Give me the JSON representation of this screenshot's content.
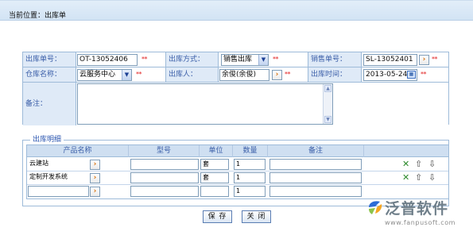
{
  "breadcrumb": "当前位置：出库单",
  "form": {
    "row1": {
      "doc_no_label": "出库单号：",
      "doc_no_value": "OT-13052406",
      "method_label": "出库方式：",
      "method_value": "销售出库",
      "sales_no_label": "销售单号：",
      "sales_no_value": "SL-13052401"
    },
    "row2": {
      "warehouse_label": "仓库名称：",
      "warehouse_value": "云服务中心",
      "person_label": "出库人：",
      "person_value": "余俊(余俊)",
      "time_label": "出库时间：",
      "time_value": "2013-05-24"
    },
    "row3": {
      "remark_label": "备注："
    },
    "required_mark": "**"
  },
  "details": {
    "legend": "出库明细",
    "headers": [
      "产品名称",
      "型号",
      "单位",
      "数量",
      "备注"
    ],
    "rows": [
      {
        "product": "云建站",
        "model": "",
        "unit": "套",
        "qty": "1",
        "remark": ""
      },
      {
        "product": "定制开发系统",
        "model": "",
        "unit": "套",
        "qty": "1",
        "remark": ""
      },
      {
        "product": "",
        "model": "",
        "unit": "",
        "qty": "1",
        "remark": ""
      }
    ]
  },
  "buttons": {
    "save": "保 存",
    "close": "关 闭"
  },
  "logo": {
    "name": "泛普软件",
    "url": "www.fanpusoft.com"
  },
  "icons": {
    "picker": "picker-arrow-icon",
    "calendar": "calendar-icon",
    "delete": "delete-x-icon",
    "up": "arrow-up-icon",
    "down": "arrow-down-icon"
  },
  "colors": {
    "label_bg": "#dfeaf7",
    "label_text": "#3a5ea8",
    "required": "#e02020",
    "border": "#9ebbd9"
  }
}
